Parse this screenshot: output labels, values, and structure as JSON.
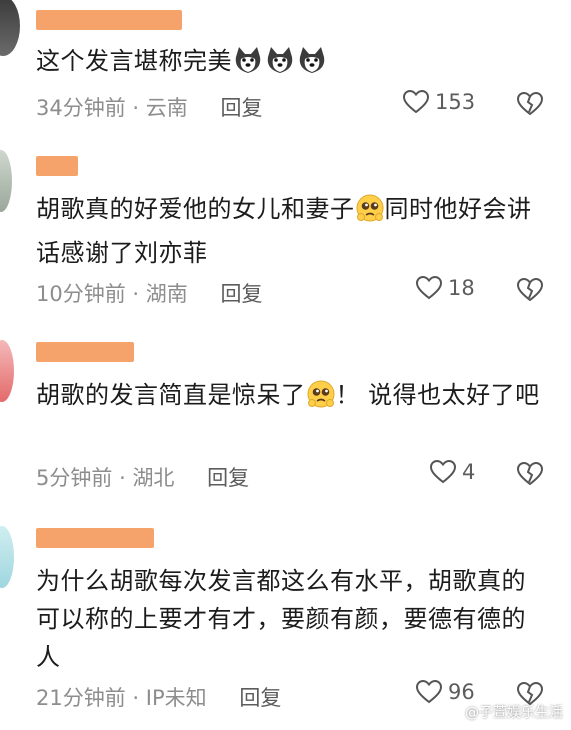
{
  "comments": [
    {
      "text": "这个发言堪称完美",
      "emoji_names": [
        "husky-dog-face-emoji",
        "husky-dog-face-emoji",
        "husky-dog-face-emoji"
      ],
      "time": "34分钟前",
      "location": "云南",
      "reply": "回复",
      "likes": "153"
    },
    {
      "text_part1": "胡歌真的好爱他的女儿和妻子",
      "emoji_name": "pleading-face-emoji",
      "text_part2": "同时他好会讲话感谢了刘亦菲",
      "time": "10分钟前",
      "location": "湖南",
      "reply": "回复",
      "likes": "18"
    },
    {
      "text_part1": "胡歌的发言简直是惊呆了",
      "emoji_name": "pleading-face-emoji",
      "text_part2": "！ 说得也太好了吧",
      "time": "5分钟前",
      "location": "湖北",
      "reply": "回复",
      "likes": "4"
    },
    {
      "text": "为什么胡歌每次发言都这么有水平，胡歌真的可以称的上要才有才，要颜有颜，要德有德的人",
      "time": "21分钟前",
      "location": "IP未知",
      "reply": "回复",
      "likes": "96"
    }
  ],
  "separator": "·",
  "watermark": "@子萱娱乐生活",
  "colors": {
    "name_redaction": "#f6a36b",
    "meta_gray": "#8d8d8d",
    "text": "#1c1c1c"
  }
}
